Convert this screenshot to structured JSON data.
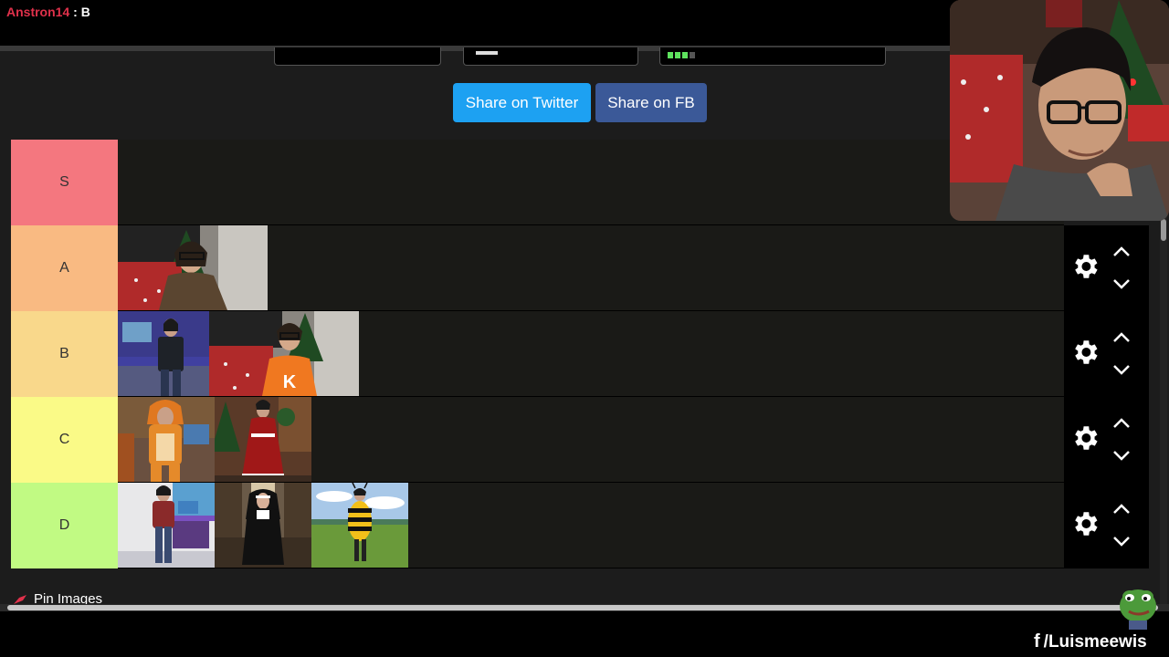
{
  "chat": {
    "user": "Anstron14",
    "separator": " : ",
    "message": "B"
  },
  "share": {
    "twitter_label": "Share on Twitter",
    "fb_label": "Share on FB"
  },
  "tiers": [
    {
      "label": "S",
      "color": "#f4777f"
    },
    {
      "label": "A",
      "color": "#f9ba82"
    },
    {
      "label": "B",
      "color": "#f9d88b"
    },
    {
      "label": "C",
      "color": "#fafa87"
    },
    {
      "label": "D",
      "color": "#c1fa83"
    }
  ],
  "pin": {
    "label": "Pin Images"
  },
  "social": {
    "handle": "/Luismeewis",
    "platform_icon": "facebook-icon"
  }
}
